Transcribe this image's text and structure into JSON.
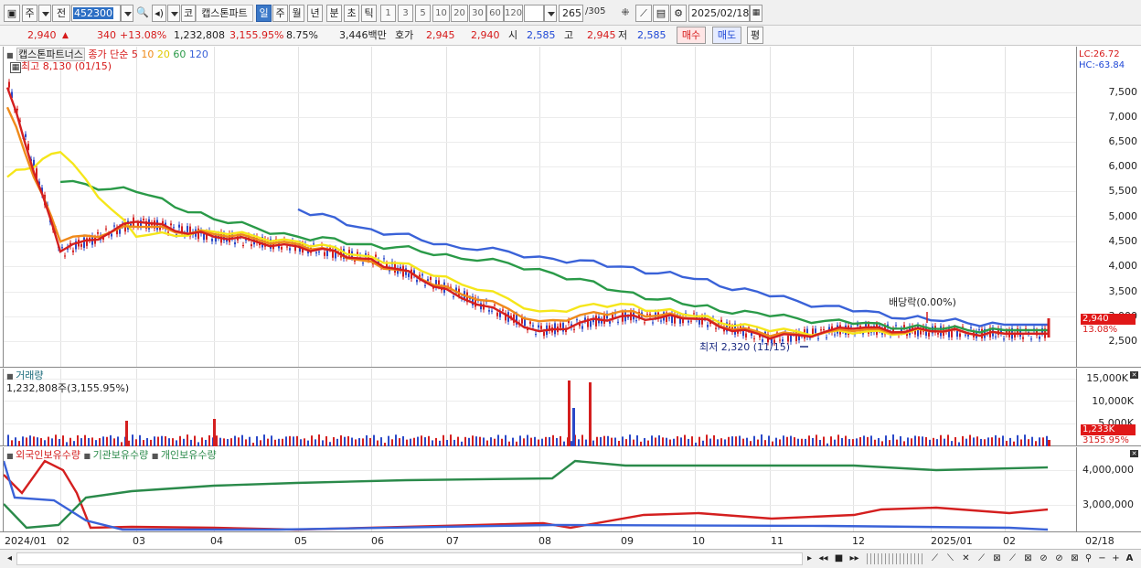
{
  "toolbar": {
    "mode_main": "주",
    "mode_sub": "전",
    "code": "452300",
    "sound_icon": "speaker-icon",
    "market_button": "코",
    "stock_name": "캡스톤파트",
    "periods": [
      "일",
      "주",
      "월",
      "년",
      "분",
      "초",
      "틱"
    ],
    "selected_period": "일",
    "intervals": [
      "1",
      "3",
      "5",
      "10",
      "20",
      "30",
      "60",
      "120"
    ],
    "count_value": "265",
    "count_total": "/305",
    "date": "2025/02/18"
  },
  "quote": {
    "price": "2,940",
    "change": "340",
    "change_pct": "+13.08%",
    "volume": "1,232,808",
    "volume_pct": "3,155.95%",
    "turnover_pct": "8.75%",
    "amount": "3,446백만",
    "hoga_label": "호가",
    "ask": "2,945",
    "bid": "2,940",
    "open_label": "시",
    "open": "2,585",
    "high_label": "고",
    "high": "2,945",
    "low_label": "저",
    "low": "2,585",
    "buy_button": "매수",
    "sell_button": "매도",
    "eval_button": "평"
  },
  "price_panel": {
    "legend_name": "캡스톤파트너스",
    "legend_series": "종가 단순",
    "ma_labels": [
      "5",
      "10",
      "20",
      "60",
      "120"
    ],
    "ma_colors": [
      "#d41f1f",
      "#ef8a1a",
      "#f5e61a",
      "#2a9a48",
      "#3a62d8"
    ],
    "high_marker": "최고 8,130 (01/15)",
    "low_marker": "최저 2,320 (11/15)",
    "dividend_marker": "배당락(0.00%)",
    "lc": "LC:26.72",
    "hc": "HC:-63.84",
    "current_price_tag": "2,940",
    "current_pct_tag": "13.08%",
    "y_ticks": [
      "7,500",
      "7,000",
      "6,500",
      "6,000",
      "5,500",
      "5,000",
      "4,500",
      "4,000",
      "3,500",
      "3,000",
      "2,500"
    ]
  },
  "volume_panel": {
    "title": "거래량",
    "subtitle": "1,232,808주(3,155.95%)",
    "y_ticks": [
      "15,000K",
      "10,000K",
      "5,000K"
    ],
    "current_tag": "1,233K",
    "current_pct": "3155.95%"
  },
  "holdings_panel": {
    "legends": [
      "외국인보유수량",
      "기관보유수량",
      "개인보유수량"
    ],
    "legend_colors": [
      "#d41f1f",
      "#2a8a4a",
      "#3a62d8"
    ],
    "y_ticks": [
      "4,000,000",
      "3,000,000"
    ]
  },
  "date_axis": {
    "labels": [
      "2024/01",
      "02",
      "03",
      "04",
      "05",
      "06",
      "07",
      "08",
      "09",
      "10",
      "11",
      "12",
      "2025/01",
      "02"
    ],
    "right_label": "02/18"
  },
  "chart_data": {
    "type": "line",
    "title": "캡스톤파트너스",
    "y_range": [
      2320,
      8130
    ],
    "high": {
      "label": "최고 8,130 (01/15)",
      "value": 8130
    },
    "low": {
      "label": "최저 2,320 (11/15)",
      "value": 2320
    },
    "x": [
      "2024/01",
      "02",
      "03",
      "04",
      "05",
      "06",
      "07",
      "08",
      "09",
      "10",
      "11",
      "12",
      "2025/01",
      "02"
    ],
    "series": [
      {
        "name": "5",
        "color": "#d41f1f",
        "values": [
          7600,
          4300,
          4900,
          4600,
          4400,
          4150,
          3550,
          2700,
          3000,
          2950,
          2550,
          2750,
          2700,
          2650
        ]
      },
      {
        "name": "10",
        "color": "#ef8a1a",
        "values": [
          7200,
          4500,
          4800,
          4650,
          4450,
          4100,
          3600,
          2900,
          3100,
          2950,
          2600,
          2700,
          2700,
          2650
        ]
      },
      {
        "name": "20",
        "color": "#f5e61a",
        "values": [
          5800,
          6300,
          4600,
          4700,
          4500,
          4200,
          3800,
          3100,
          3250,
          3000,
          2700,
          2650,
          2700,
          2650
        ]
      },
      {
        "name": "60",
        "color": "#2a9a48",
        "values": [
          null,
          5700,
          5500,
          4950,
          4600,
          4450,
          4250,
          3950,
          3500,
          3200,
          3000,
          2850,
          2750,
          2720
        ]
      },
      {
        "name": "120",
        "color": "#3a62d8",
        "values": [
          null,
          null,
          null,
          null,
          5150,
          4750,
          4450,
          4200,
          4000,
          3750,
          3400,
          3100,
          2920,
          2830
        ]
      }
    ],
    "volume_spikes": [
      {
        "x": "08",
        "value": 14500
      },
      {
        "x": "08",
        "value": 14500
      }
    ],
    "holdings": [
      {
        "name": "외국인보유수량",
        "color": "#d41f1f"
      },
      {
        "name": "기관보유수량",
        "color": "#2a8a4a"
      },
      {
        "name": "개인보유수량",
        "color": "#3a62d8"
      }
    ]
  }
}
